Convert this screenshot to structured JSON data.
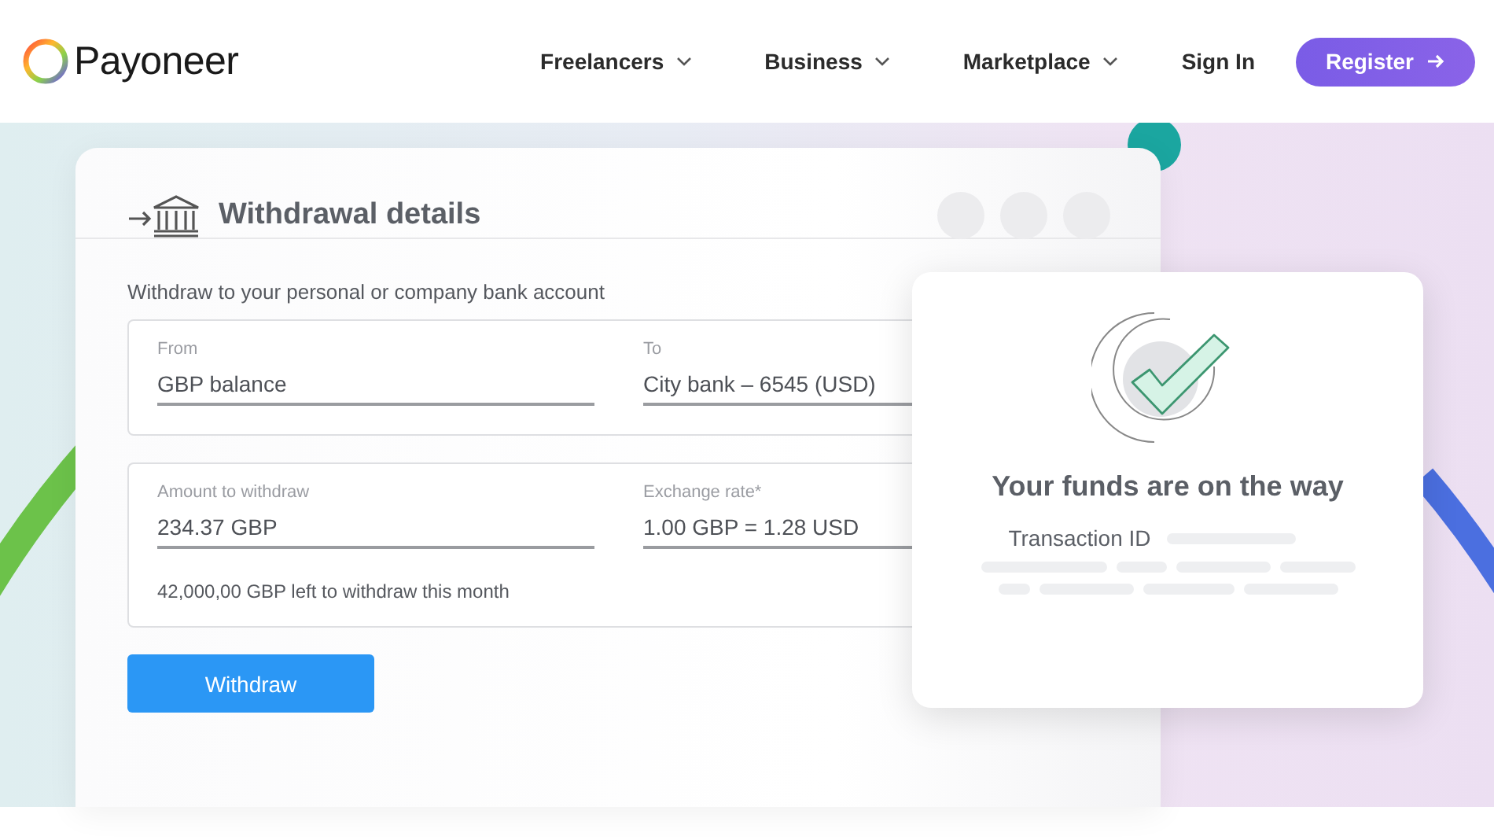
{
  "header": {
    "logo": "Payoneer",
    "nav": [
      {
        "label": "Freelancers",
        "dropdown": true
      },
      {
        "label": "Business",
        "dropdown": true
      },
      {
        "label": "Marketplace",
        "dropdown": true
      },
      {
        "label": "Sign In",
        "dropdown": false
      }
    ],
    "register": "Register"
  },
  "withdrawal_card": {
    "title": "Withdrawal details",
    "subtitle": "Withdraw to your personal or company bank account",
    "groups": [
      {
        "fields": [
          {
            "label": "From",
            "value": "GBP balance"
          },
          {
            "label": "To",
            "value": "City bank – 6545 (USD)"
          }
        ]
      },
      {
        "fields": [
          {
            "label": "Amount to withdraw",
            "value": "234.37 GBP"
          },
          {
            "label": "Exchange rate*",
            "value": "1.00 GBP = 1.28 USD"
          }
        ],
        "note": "42,000,00 GBP left to withdraw this month"
      }
    ],
    "button": "Withdraw"
  },
  "success_card": {
    "title": "Your funds are on the way",
    "transaction_label": "Transaction ID"
  }
}
